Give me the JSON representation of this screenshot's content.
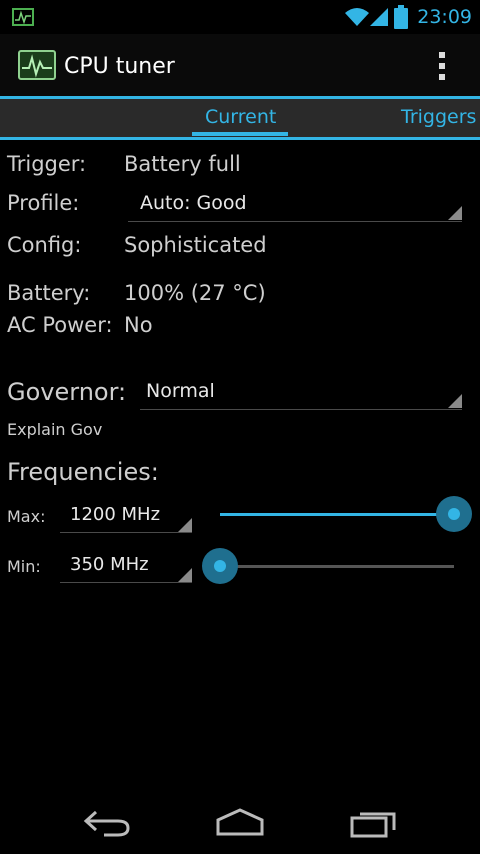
{
  "status_bar": {
    "time": "23:09"
  },
  "action_bar": {
    "title": "CPU tuner"
  },
  "tabs": [
    {
      "label": "Current",
      "selected": true
    },
    {
      "label": "Triggers",
      "selected": false
    }
  ],
  "info": {
    "trigger_label": "Trigger:",
    "trigger_value": "Battery full",
    "profile_label": "Profile:",
    "profile_value": "Auto: Good",
    "config_label": "Config:",
    "config_value": "Sophisticated",
    "battery_label": "Battery:",
    "battery_value": "100% (27 °C)",
    "ac_label": "AC Power:",
    "ac_value": "No"
  },
  "governor": {
    "label": "Governor:",
    "value": "Normal",
    "explain": "Explain Gov"
  },
  "frequencies": {
    "heading": "Frequencies:",
    "max_label": "Max:",
    "max_value": "1200 MHz",
    "max_slider_fraction": 1.0,
    "min_label": "Min:",
    "min_value": "350 MHz",
    "min_slider_fraction": 0.0
  },
  "colors": {
    "accent": "#33b5e5",
    "background": "#000000"
  }
}
